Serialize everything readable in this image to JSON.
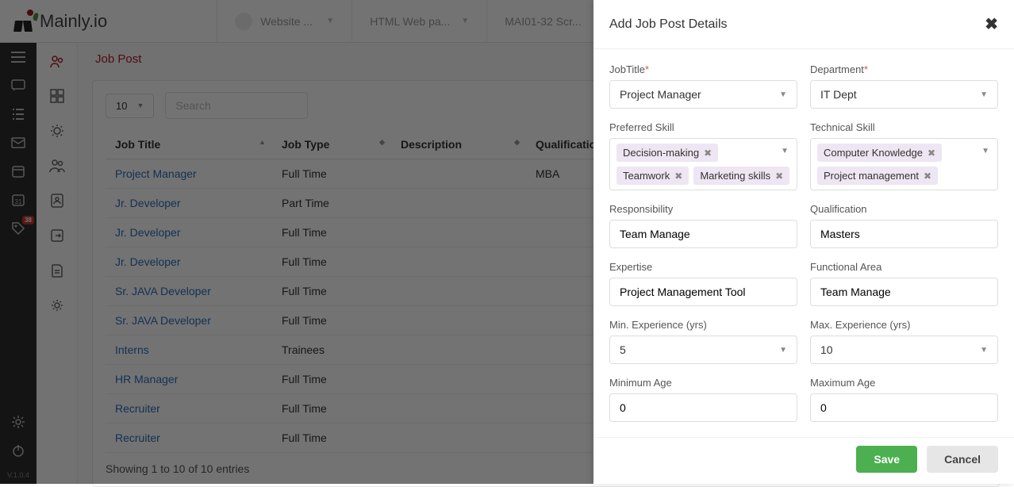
{
  "brand": "Mainly.io",
  "topbar": {
    "items": [
      {
        "label": "Website ..."
      },
      {
        "label": "HTML Web pa..."
      },
      {
        "label": "MAI01-32 Scr..."
      }
    ]
  },
  "leftrail": {
    "notification_badge": "38",
    "version": "V.1.0.4"
  },
  "breadcrumb": "Job Post",
  "table": {
    "page_length": "10",
    "search_placeholder": "Search",
    "columns": [
      "Job Title",
      "Job Type",
      "Description",
      "Qualification"
    ],
    "rows": [
      {
        "title": "Project Manager",
        "type": "Full Time",
        "desc": "",
        "qual": "MBA"
      },
      {
        "title": "Jr. Developer",
        "type": "Part Time",
        "desc": "",
        "qual": ""
      },
      {
        "title": "Jr. Developer",
        "type": "Full Time",
        "desc": "",
        "qual": ""
      },
      {
        "title": "Jr. Developer",
        "type": "Full Time",
        "desc": "",
        "qual": ""
      },
      {
        "title": "Sr. JAVA Developer",
        "type": "Full Time",
        "desc": "",
        "qual": ""
      },
      {
        "title": "Sr. JAVA Developer",
        "type": "Full Time",
        "desc": "",
        "qual": ""
      },
      {
        "title": "Interns",
        "type": "Trainees",
        "desc": "",
        "qual": ""
      },
      {
        "title": "HR Manager",
        "type": "Full Time",
        "desc": "",
        "qual": ""
      },
      {
        "title": "Recruiter",
        "type": "Full Time",
        "desc": "",
        "qual": ""
      },
      {
        "title": "Recruiter",
        "type": "Full Time",
        "desc": "",
        "qual": ""
      }
    ],
    "info": "Showing 1 to 10 of 10 entries"
  },
  "drawer": {
    "title": "Add Job Post Details",
    "jobtitle_label": "JobTitle",
    "jobtitle_value": "Project Manager",
    "department_label": "Department",
    "department_value": "IT Dept",
    "preferred_label": "Preferred Skill",
    "preferred_tags": [
      "Decision-making",
      "Teamwork",
      "Marketing skills"
    ],
    "technical_label": "Technical Skill",
    "technical_tags": [
      "Computer Knowledge",
      "Project management"
    ],
    "responsibility_label": "Responsibility",
    "responsibility_value": "Team Manage",
    "qualification_label": "Qualification",
    "qualification_value": "Masters",
    "expertise_label": "Expertise",
    "expertise_value": "Project Management Tool",
    "functional_label": "Functional Area",
    "functional_value": "Team Manage",
    "minexp_label": "Min. Experience (yrs)",
    "minexp_value": "5",
    "maxexp_label": "Max. Experience (yrs)",
    "maxexp_value": "10",
    "minage_label": "Minimum Age",
    "minage_value": "0",
    "maxage_label": "Maximum Age",
    "maxage_value": "0",
    "save_label": "Save",
    "cancel_label": "Cancel"
  }
}
